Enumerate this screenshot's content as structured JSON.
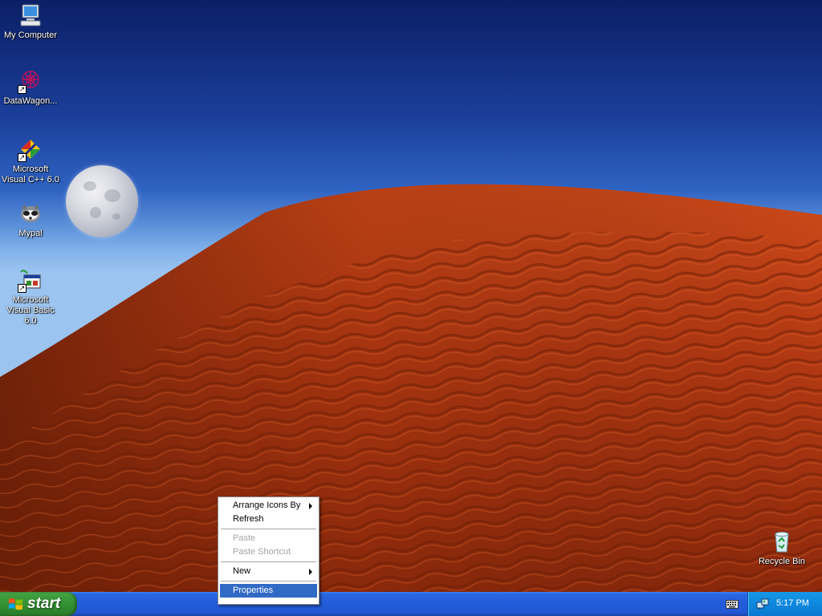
{
  "desktop_icons": [
    {
      "label": "My Computer",
      "icon": "computer-icon"
    },
    {
      "label": "DataWagon...",
      "icon": "datawagon-icon"
    },
    {
      "label": "Microsoft Visual C++ 6.0",
      "icon": "visual-cpp-icon"
    },
    {
      "label": "Mypal",
      "icon": "mypal-icon"
    },
    {
      "label": "Microsoft Visual Basic 6.0",
      "icon": "visual-basic-icon"
    },
    {
      "label": "Recycle Bin",
      "icon": "recycle-bin-icon"
    }
  ],
  "context_menu": {
    "items": [
      {
        "label": "Arrange Icons By",
        "submenu": true,
        "enabled": true
      },
      {
        "label": "Refresh",
        "submenu": false,
        "enabled": true
      },
      {
        "label": "Paste",
        "submenu": false,
        "enabled": false
      },
      {
        "label": "Paste Shortcut",
        "submenu": false,
        "enabled": false
      },
      {
        "label": "New",
        "submenu": true,
        "enabled": true
      },
      {
        "label": "Properties",
        "submenu": false,
        "enabled": true,
        "selected": true
      }
    ]
  },
  "taskbar": {
    "start_label": "start",
    "clock": "5:17 PM",
    "tray_icons": [
      "keyboard-icon",
      "network-icon"
    ]
  },
  "colors": {
    "taskbar_blue": "#245edc",
    "start_green": "#3c9c3c",
    "menu_highlight": "#316ac5",
    "dune_red": "#b23a14"
  }
}
